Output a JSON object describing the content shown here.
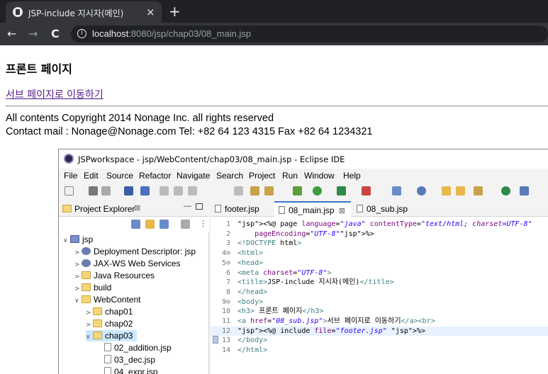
{
  "browser": {
    "tab_title": "JSP-include 지시자(메인)",
    "close_glyph": "×",
    "new_tab_glyph": "+",
    "back_glyph": "←",
    "forward_glyph": "→",
    "reload_glyph": "C",
    "info_glyph": "i",
    "url_host": "localhost",
    "url_rest": ":8080/jsp/chap03/08_main.jsp"
  },
  "page": {
    "heading": "프론트 페이지",
    "link_text": "서브 페이지로 이동하기",
    "footer_line1": "All contents Copyright 2014 Nonage Inc. all rights reserved",
    "footer_line2": "Contact mail : Nonage@Nonage.com Tel: +82 64 123 4315 Fax +82 64 1234321"
  },
  "eclipse": {
    "window_title": "JSPworkspace - jsp/WebContent/chap03/08_main.jsp - Eclipse IDE",
    "menu": [
      "File",
      "Edit",
      "Source",
      "Refactor",
      "Navigate",
      "Search",
      "Project",
      "Run",
      "Window",
      "Help"
    ],
    "project_explorer": {
      "label": "Project Explorer",
      "tree": [
        {
          "label": "jsp",
          "arrow": "∨"
        },
        {
          "label": "Deployment Descriptor: jsp",
          "arrow": ">"
        },
        {
          "label": "JAX-WS Web Services",
          "arrow": ">"
        },
        {
          "label": "Java Resources",
          "arrow": ">"
        },
        {
          "label": "build",
          "arrow": ">"
        },
        {
          "label": "WebContent",
          "arrow": "∨"
        },
        {
          "label": "chap01",
          "arrow": ">"
        },
        {
          "label": "chap02",
          "arrow": ">"
        },
        {
          "label": "chap03",
          "arrow": "∨"
        },
        {
          "label": "02_addition.jsp",
          "arrow": ""
        },
        {
          "label": "03_dec.jsp",
          "arrow": ""
        },
        {
          "label": "04_expr.jsp",
          "arrow": ""
        }
      ]
    },
    "editor_tabs": [
      "footer.jsp",
      "08_main.jsp",
      "08_sub.jsp"
    ],
    "active_tab": "08_main.jsp",
    "code_lines": [
      {
        "n": "1",
        "text": "<%@ page language=\"java\" contentType=\"text/html; charset=UTF-8\""
      },
      {
        "n": "2",
        "text": "    pageEncoding=\"UTF-8\"%>"
      },
      {
        "n": "3",
        "text": "<!DOCTYPE html>"
      },
      {
        "n": "4⊖",
        "text": "<html>"
      },
      {
        "n": "5⊖",
        "text": "<head>"
      },
      {
        "n": "6",
        "text": "<meta charset=\"UTF-8\">"
      },
      {
        "n": "7",
        "text": "<title>JSP-include 지시자(메인)</title>"
      },
      {
        "n": "8",
        "text": "</head>"
      },
      {
        "n": "9⊖",
        "text": "<body>"
      },
      {
        "n": "10",
        "text": "<h3> 프론트 페이지</h3>"
      },
      {
        "n": "11",
        "text": "<a href=\"08_sub.jsp\">서브 페이지로 이동하기</a><br>"
      },
      {
        "n": "12",
        "text": "<%@ include file=\"footer.jsp\" %>"
      },
      {
        "n": "13",
        "text": "</body>"
      },
      {
        "n": "14",
        "text": "</html>"
      }
    ]
  }
}
